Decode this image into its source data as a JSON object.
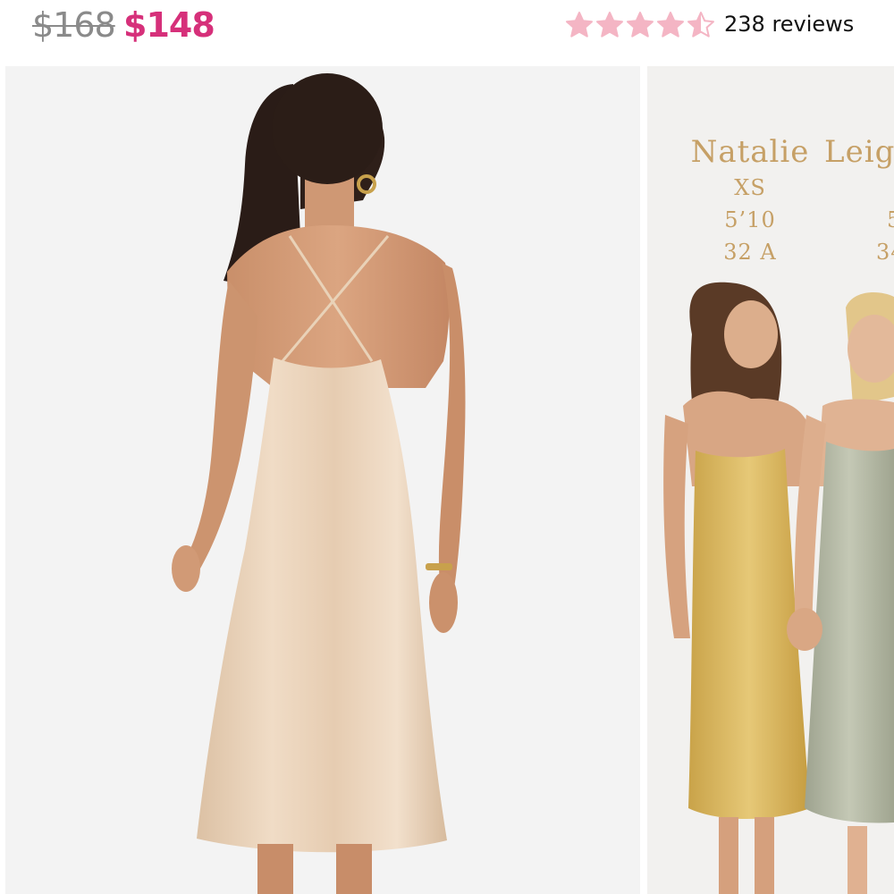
{
  "price": {
    "original": "$168",
    "sale": "$148"
  },
  "rating": {
    "value": 4.5,
    "max": 5,
    "color": "#f4b5c4",
    "reviews_label": "238 reviews"
  },
  "gallery": {
    "slides": [
      {
        "subject": "back view of champagne satin slip dress"
      },
      {
        "subject": "two models in satin slip dresses",
        "models": [
          {
            "name": "Natalie",
            "size": "XS",
            "height": "5’10",
            "bust": "32 A"
          },
          {
            "name": "Leig",
            "size": "",
            "height": "5",
            "bust": "34"
          }
        ]
      }
    ]
  },
  "colors": {
    "sale_price": "#d6307a",
    "original_price": "#8a8a8a",
    "model_text": "#c6a066"
  }
}
